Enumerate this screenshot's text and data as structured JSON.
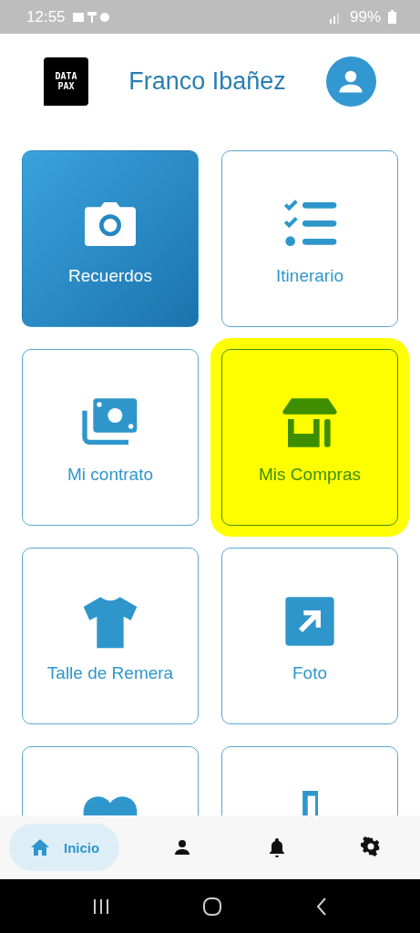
{
  "status_bar": {
    "time": "12:55",
    "battery": "99%"
  },
  "header": {
    "logo_text": [
      "DATA",
      "PAX"
    ],
    "user_name": "Franco Ibañez"
  },
  "tiles": [
    {
      "label": "Recuerdos",
      "kind": "filled"
    },
    {
      "label": "Itinerario",
      "kind": "outline"
    },
    {
      "label": "Mi contrato",
      "kind": "outline"
    },
    {
      "label": "Mis Compras",
      "kind": "highlighted"
    },
    {
      "label": "Talle de Remera",
      "kind": "outline"
    },
    {
      "label": "Foto",
      "kind": "outline"
    },
    {
      "kind": "outline"
    },
    {
      "kind": "outline"
    }
  ],
  "bottom_nav": [
    {
      "label": "Inicio",
      "selected": true
    },
    {
      "selected": false
    },
    {
      "selected": false
    },
    {
      "selected": false
    }
  ]
}
